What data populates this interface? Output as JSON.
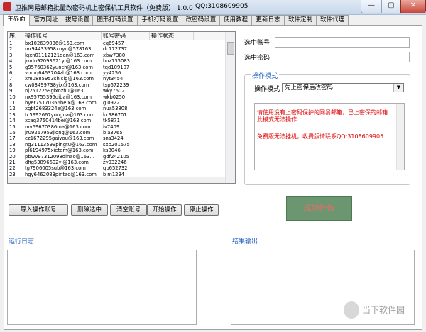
{
  "window": {
    "title": "卫推网易邮箱批量改密码机上密保机工具软件（免费版）   1.0.0",
    "qq": "QQ:3108609905",
    "min": "—",
    "max": "▢",
    "close": "✕"
  },
  "tabs": [
    "主界面",
    "官方网址",
    "拔号设置",
    "图形打码设置",
    "手机打码设置",
    "改密码设置",
    "使用教程",
    "更新日志",
    "软件定制",
    "软件代理"
  ],
  "table": {
    "columns": [
      "序.",
      "操作账号",
      "账号密码",
      "操作状态"
    ],
    "rows": [
      [
        "1",
        "bx102639036@163.com",
        "cq69457"
      ],
      [
        "2",
        "mr94433958xuyu@578163...",
        "dc172737"
      ],
      [
        "3",
        "lqxn01112121den@163.com",
        "xbw7380"
      ],
      [
        "4",
        "jmdn92093621yi@163.com",
        "hoz135083"
      ],
      [
        "5",
        "g95760362yunch@163.com",
        "tqd109107"
      ],
      [
        "6",
        "vomq6463704zh@163.com",
        "yy4256"
      ],
      [
        "7",
        "xm0885953shicig@163.com",
        "nyt3454"
      ],
      [
        "8",
        "cw03499738yix@163.com",
        "tsp672239"
      ],
      [
        "9",
        "nj2512259gixozhu@163...",
        "wky7602"
      ],
      [
        "10",
        "nx95755395diba@163.com",
        "wkb0250"
      ],
      [
        "11",
        "byer75170366beix@163.com",
        "gl0922"
      ],
      [
        "12",
        "xgbt2683324e@163.com",
        "nua53808"
      ],
      [
        "13",
        "tc5992667yongna@163.com",
        "kc986701"
      ],
      [
        "14",
        "xcaq3750414bei@163.com",
        "tk5871"
      ],
      [
        "15",
        "mv69670386ma@163.com",
        "iv7409"
      ],
      [
        "16",
        "jr09267953jiong@163.com",
        "bla3765"
      ],
      [
        "17",
        "ez1672295gaiyou@163.com",
        "sns3424"
      ],
      [
        "18",
        "ng31113599pingtu@163.com",
        "sxb201575"
      ],
      [
        "19",
        "pl6194975xietem@163.com",
        "ks8046"
      ],
      [
        "20",
        "pbwv97312098dinao@163...",
        "gdf242105"
      ],
      [
        "21",
        "dfig53896692yi@163.com",
        "zy932246"
      ],
      [
        "22",
        "tg7906005sub@163.com",
        "qp652732"
      ],
      [
        "23",
        "hgy6462083pintao@163.com",
        "bjm1294"
      ],
      [
        "24",
        "b09258419qinyu@163.com",
        "fr7655"
      ]
    ]
  },
  "buttons": {
    "import": "导入操作账号",
    "delete": "删除选中",
    "clear": "清空账号",
    "start": "开始操作",
    "stop": "停止操作"
  },
  "form": {
    "selected_account_label": "选中账号",
    "selected_password_label": "选中密码",
    "selected_account_value": "",
    "selected_password_value": ""
  },
  "mode": {
    "group_title": "操作模式",
    "label": "操作模式",
    "value": "先上密保后改密码",
    "arrow": "▼"
  },
  "notice": {
    "line1": "请使用没有上密码保护的网易邮箱，已上密保的邮箱此模式无法操作",
    "line2": "免费版无法挂机，收费版请联系QQ:3108609905"
  },
  "success_label": "成功计数",
  "log": {
    "title": "运行日志"
  },
  "output": {
    "title": "结果输出"
  },
  "watermark": {
    "text": "当下软件园"
  },
  "colors": {
    "notice_text": "#e00000",
    "success_bg": "#6b9670",
    "success_text": "#f26a6a",
    "legend": "#1f5fbf"
  }
}
